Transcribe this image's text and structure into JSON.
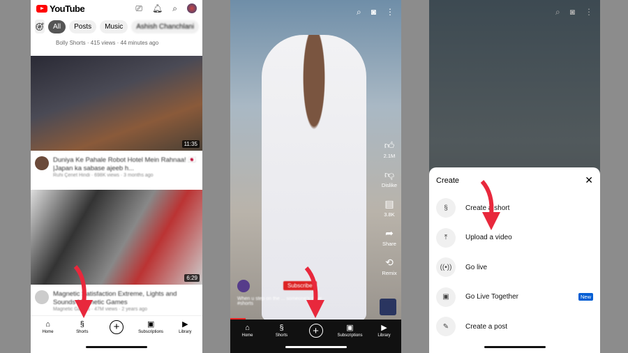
{
  "home": {
    "logo": "YouTube",
    "icons": [
      "cast-icon",
      "bell-icon",
      "search-icon",
      "avatar"
    ],
    "chips": [
      "All",
      "Posts",
      "Music",
      "Ashish Chanchlani"
    ],
    "meta": "Bolly Shorts · 415 views · 44 minutes ago",
    "videos": [
      {
        "title": "Duniya Ke Pahale Robot Hotel Mein Rahnaa! 🇯🇵 |Japan ka sabase ajeeb h...",
        "sub": "Ruhi Çenet Hindi · 698K views · 3 months ago",
        "duration": "11:35"
      },
      {
        "title": "Magnetic Satisfaction Extreme, Lights and Sounds Magnetic Games",
        "sub": "Magnetic Games · 47M views · 2 years ago",
        "duration": "6:29"
      }
    ]
  },
  "nav": {
    "home": "Home",
    "shorts": "Shorts",
    "subscriptions": "Subscriptions",
    "library": "Library"
  },
  "short": {
    "likes": "2.1M",
    "dislike": "Dislike",
    "comments": "3.8K",
    "share": "Share",
    "remix": "Remix",
    "subscribe": "Subscribe",
    "caption": "When u step on the ... someone's shoe",
    "tag": "#shorts"
  },
  "create": {
    "title": "Create",
    "options": [
      {
        "label": "Create a short",
        "icon": "shorts-icon"
      },
      {
        "label": "Upload a video",
        "icon": "upload-icon"
      },
      {
        "label": "Go live",
        "icon": "live-icon"
      },
      {
        "label": "Go Live Together",
        "icon": "live-together-icon",
        "badge": "New"
      },
      {
        "label": "Create a post",
        "icon": "edit-icon"
      }
    ]
  },
  "colors": {
    "accent": "#ff0000",
    "arrow": "#e8283c",
    "badge": "#065fd4"
  }
}
